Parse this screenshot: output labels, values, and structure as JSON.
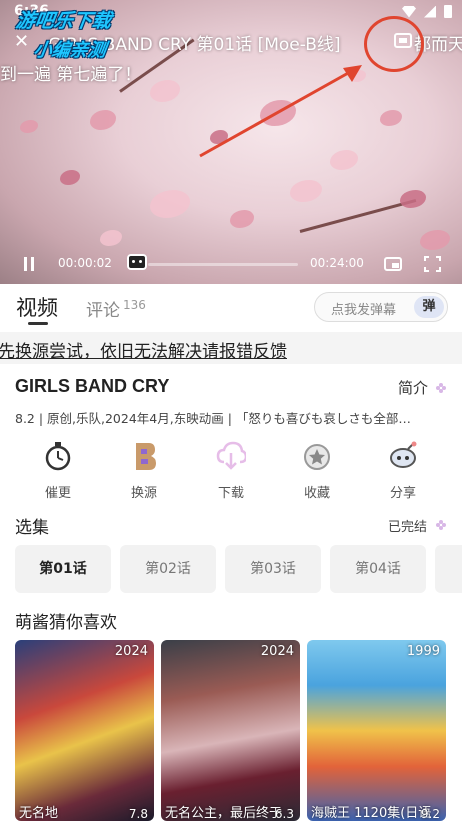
{
  "status_bar": {
    "time": "6:36"
  },
  "watermark": {
    "line1": "游吧乐下载",
    "line2": "小编亲测"
  },
  "player": {
    "title": "GIRLS BAND CRY 第01话 [Moe-B线]",
    "top_right_text": "都而天",
    "danmaku_line": "到一遍 第七遍了！",
    "current_time": "00:00:02",
    "total_time": "00:24:00",
    "progress": 0.0
  },
  "tabs": {
    "video_label": "视频",
    "comment_label": "评论",
    "comment_count": "136",
    "danmaku_placeholder": "点我发弹幕",
    "danmaku_button": "弹"
  },
  "notice": "先换源尝试，依旧无法解决请报错反馈",
  "anime": {
    "title": "GIRLS BAND CRY",
    "intro_label": "简介",
    "meta": "8.2 | 原创,乐队,2024年4月,东映动画 | 「怒りも喜びも哀しさも全部…"
  },
  "actions": [
    {
      "label": "催更",
      "icon": "stopwatch-icon"
    },
    {
      "label": "换源",
      "icon": "source-switch-icon"
    },
    {
      "label": "下载",
      "icon": "cloud-download-icon"
    },
    {
      "label": "收藏",
      "icon": "star-favorite-icon"
    },
    {
      "label": "分享",
      "icon": "share-icon"
    }
  ],
  "episodes_section": {
    "title": "选集",
    "status": "已完结"
  },
  "episodes": [
    "第01话",
    "第02话",
    "第03话",
    "第04话",
    "第"
  ],
  "recommend_section": {
    "title": "萌酱猜你喜欢"
  },
  "recommendations": [
    {
      "year": "2024",
      "name": "无名地",
      "score": "7.8"
    },
    {
      "year": "2024",
      "name": "无名公主，最后终于",
      "score": "6.3"
    },
    {
      "year": "1999",
      "name": "海贼王 1120集(日语",
      "score": "9.2"
    }
  ],
  "colors": {
    "accent_purple": "#d8b7e6",
    "annotation_red": "#e0452f",
    "watermark_blue": "#1ec6ff"
  }
}
